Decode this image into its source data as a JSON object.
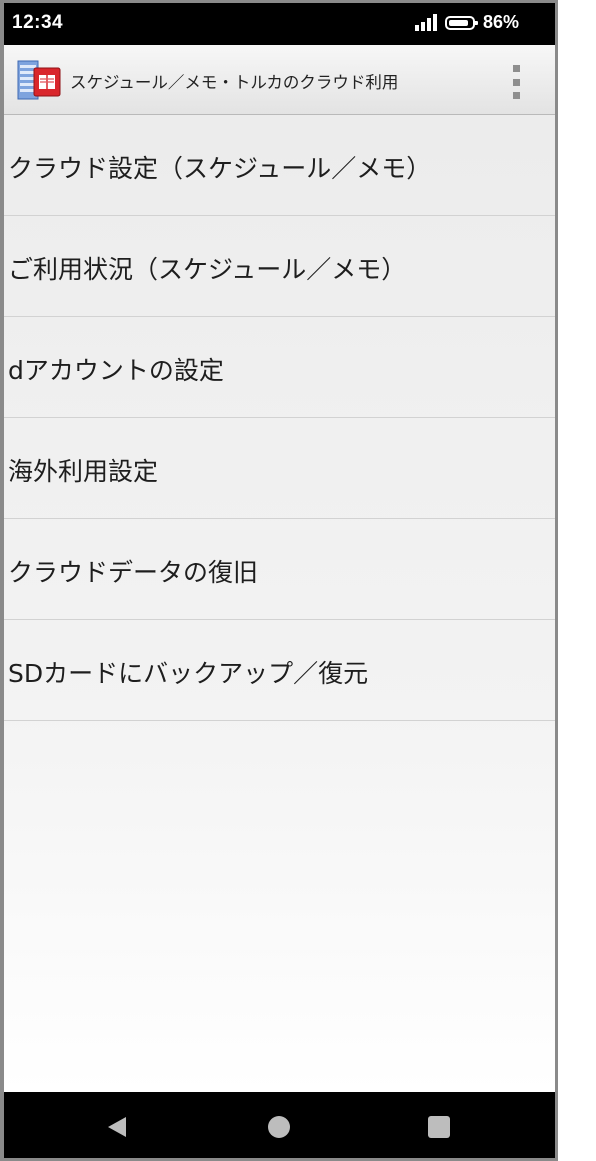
{
  "status_bar": {
    "time": "12:34",
    "battery_percent": "86%",
    "battery_level": 0.86,
    "signal_bars": 4
  },
  "app_bar": {
    "title": "スケジュール／メモ・トルカのクラウド利用",
    "app_icon": "schedule-book-app-icon",
    "menu_icon": "overflow-menu-icon"
  },
  "menu": {
    "items": [
      {
        "label": "クラウド設定（スケジュール／メモ）"
      },
      {
        "label": "ご利用状況（スケジュール／メモ）"
      },
      {
        "label": "dアカウントの設定"
      },
      {
        "label": "海外利用設定"
      },
      {
        "label": "クラウドデータの復旧"
      },
      {
        "label": "SDカードにバックアップ／復元"
      }
    ]
  },
  "nav_bar": {
    "icons": [
      "back-icon",
      "home-icon",
      "recents-icon"
    ]
  },
  "colors": {
    "status_bar_bg": "#000000",
    "app_bar_bg": "#ececec",
    "list_text": "#1e1e1e",
    "divider": "#d2d2d2",
    "app_icon_red": "#d9262c",
    "app_icon_blue": "#5b8bd6"
  }
}
